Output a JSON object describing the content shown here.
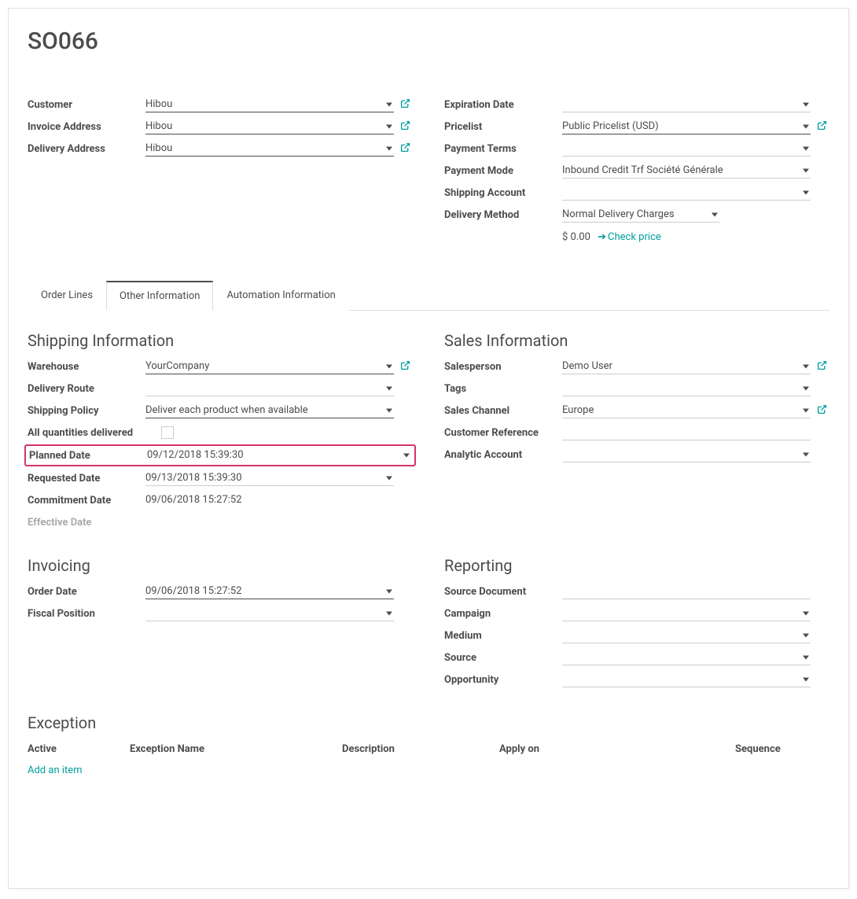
{
  "title": "SO066",
  "left1": {
    "customer_label": "Customer",
    "customer_value": "Hibou",
    "invoice_label": "Invoice Address",
    "invoice_value": "Hibou",
    "delivery_label": "Delivery Address",
    "delivery_value": "Hibou"
  },
  "right1": {
    "expiration_label": "Expiration Date",
    "expiration_value": "",
    "pricelist_label": "Pricelist",
    "pricelist_value": "Public Pricelist (USD)",
    "payterms_label": "Payment Terms",
    "payterms_value": "",
    "paymode_label": "Payment Mode",
    "paymode_value": "Inbound Credit Trf Société Générale",
    "shipacct_label": "Shipping Account",
    "shipacct_value": "",
    "delivmeth_label": "Delivery Method",
    "delivmeth_value": "Normal Delivery Charges",
    "price_amount": "$ 0.00",
    "check_price": "Check price"
  },
  "tabs": {
    "order_lines": "Order Lines",
    "other_info": "Other Information",
    "automation": "Automation Information"
  },
  "shipping": {
    "heading": "Shipping Information",
    "warehouse_label": "Warehouse",
    "warehouse_value": "YourCompany",
    "route_label": "Delivery Route",
    "route_value": "",
    "policy_label": "Shipping Policy",
    "policy_value": "Deliver each product when available",
    "allqty_label": "All quantities delivered",
    "planned_label": "Planned Date",
    "planned_value": "09/12/2018 15:39:30",
    "requested_label": "Requested Date",
    "requested_value": "09/13/2018 15:39:30",
    "commitment_label": "Commitment Date",
    "commitment_value": "09/06/2018 15:27:52",
    "effective_label": "Effective Date"
  },
  "sales": {
    "heading": "Sales Information",
    "salesperson_label": "Salesperson",
    "salesperson_value": "Demo User",
    "tags_label": "Tags",
    "tags_value": "",
    "channel_label": "Sales Channel",
    "channel_value": "Europe",
    "custref_label": "Customer Reference",
    "custref_value": "",
    "analytic_label": "Analytic Account",
    "analytic_value": ""
  },
  "invoicing": {
    "heading": "Invoicing",
    "orderdate_label": "Order Date",
    "orderdate_value": "09/06/2018 15:27:52",
    "fiscal_label": "Fiscal Position",
    "fiscal_value": ""
  },
  "reporting": {
    "heading": "Reporting",
    "sourcedoc_label": "Source Document",
    "sourcedoc_value": "",
    "campaign_label": "Campaign",
    "campaign_value": "",
    "medium_label": "Medium",
    "medium_value": "",
    "source_label": "Source",
    "source_value": "",
    "opportunity_label": "Opportunity",
    "opportunity_value": ""
  },
  "exception": {
    "heading": "Exception",
    "col_active": "Active",
    "col_name": "Exception Name",
    "col_desc": "Description",
    "col_apply": "Apply on",
    "col_seq": "Sequence",
    "add_item": "Add an item"
  }
}
